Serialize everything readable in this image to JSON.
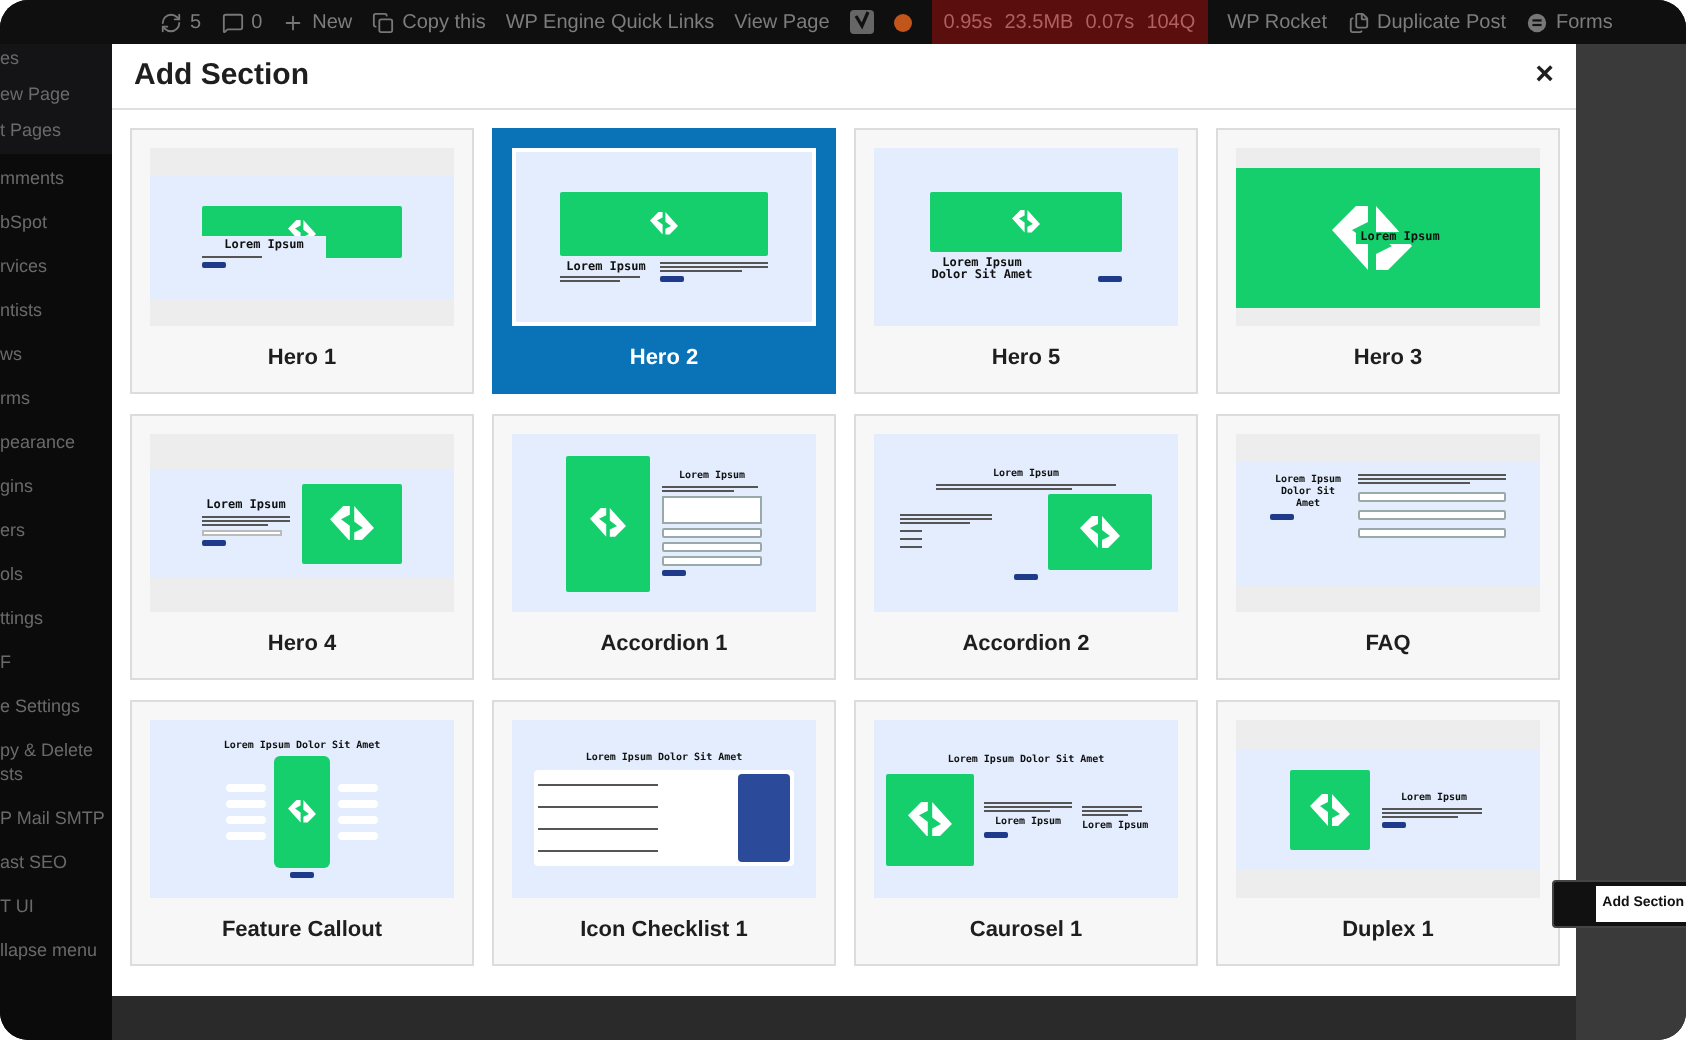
{
  "admin_bar": [
    {
      "kind": "updates",
      "text": "5"
    },
    {
      "kind": "comments",
      "text": "0"
    },
    {
      "kind": "new",
      "text": "New"
    },
    {
      "kind": "copy",
      "text": "Copy this"
    },
    {
      "kind": "link",
      "text": "WP Engine Quick Links"
    },
    {
      "kind": "link",
      "text": "View Page"
    },
    {
      "kind": "yoast"
    },
    {
      "kind": "status_dot",
      "color": "#c2561a"
    },
    {
      "kind": "metrics",
      "texts": [
        "0.95s",
        "23.5MB",
        "0.07s",
        "104Q"
      ]
    },
    {
      "kind": "link",
      "text": "WP Rocket"
    },
    {
      "kind": "duplicate",
      "text": "Duplicate Post"
    },
    {
      "kind": "forms",
      "text": "Forms"
    }
  ],
  "sidebar": {
    "submenu": [
      "es",
      "ew Page",
      "t Pages"
    ],
    "items": [
      "mments",
      "bSpot",
      "rvices",
      "ntists",
      "ws",
      "rms",
      "pearance",
      "gins",
      "ers",
      "ols",
      "ttings",
      "F",
      "e Settings",
      "py & Delete\nsts",
      "P Mail SMTP",
      "ast SEO",
      "T UI",
      "llapse menu"
    ]
  },
  "modal": {
    "title": "Add Section",
    "close": "×",
    "cards": [
      {
        "label": "Hero 1",
        "selected": false,
        "preview": {
          "kind": "hero1",
          "texts": [
            "Lorem Ipsum"
          ]
        }
      },
      {
        "label": "Hero 2",
        "selected": true,
        "preview": {
          "kind": "hero2",
          "texts": [
            "Lorem Ipsum"
          ]
        }
      },
      {
        "label": "Hero 5",
        "selected": false,
        "preview": {
          "kind": "hero5",
          "texts": [
            "Lorem Ipsum Dolor Sit Amet"
          ]
        }
      },
      {
        "label": "Hero 3",
        "selected": false,
        "preview": {
          "kind": "hero3",
          "texts": [
            "Lorem Ipsum"
          ]
        }
      },
      {
        "label": "Hero 4",
        "selected": false,
        "preview": {
          "kind": "hero4",
          "texts": [
            "Lorem Ipsum"
          ]
        }
      },
      {
        "label": "Accordion 1",
        "selected": false,
        "preview": {
          "kind": "accordion1",
          "texts": [
            "Lorem Ipsum"
          ]
        }
      },
      {
        "label": "Accordion 2",
        "selected": false,
        "preview": {
          "kind": "accordion2",
          "texts": [
            "Lorem Ipsum"
          ]
        }
      },
      {
        "label": "FAQ",
        "selected": false,
        "preview": {
          "kind": "faq",
          "texts": [
            "Lorem Ipsum Dolor Sit Amet"
          ]
        }
      },
      {
        "label": "Feature Callout",
        "selected": false,
        "preview": {
          "kind": "callout",
          "texts": [
            "Lorem Ipsum Dolor Sit Amet"
          ]
        }
      },
      {
        "label": "Icon Checklist 1",
        "selected": false,
        "preview": {
          "kind": "checklist",
          "texts": [
            "Lorem Ipsum Dolor Sit Amet"
          ]
        }
      },
      {
        "label": "Caurosel 1",
        "selected": false,
        "preview": {
          "kind": "carousel",
          "texts": [
            "Lorem Ipsum Dolor Sit Amet",
            "Lorem Ipsum",
            "Lorem Ipsum"
          ]
        }
      },
      {
        "label": "Duplex 1",
        "selected": false,
        "preview": {
          "kind": "duplex",
          "texts": [
            "Lorem Ipsum"
          ]
        }
      }
    ]
  },
  "tooltip": {
    "label": "Add Section"
  }
}
